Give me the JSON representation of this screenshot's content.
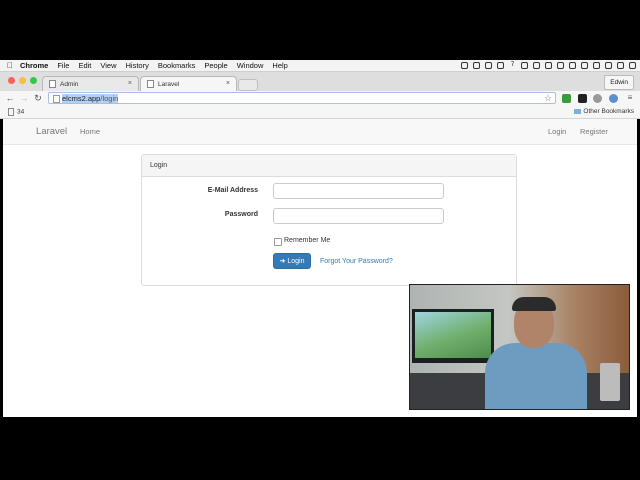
{
  "menubar": {
    "apple_icon": "apple-icon",
    "app_name": "Chrome",
    "menus": [
      "File",
      "Edit",
      "View",
      "History",
      "Bookmarks",
      "People",
      "Window",
      "Help"
    ],
    "status_items": [
      "7"
    ]
  },
  "tabs": [
    {
      "title": "Admin",
      "active": false
    },
    {
      "title": "Laravel",
      "active": true
    }
  ],
  "profile": "Edwin",
  "omnibox": {
    "url_host": "elcms2.app",
    "url_path": "/login"
  },
  "bookmarks": {
    "count_label": "34",
    "other": "Other Bookmarks"
  },
  "site": {
    "brand": "Laravel",
    "nav_home": "Home",
    "nav_login": "Login",
    "nav_register": "Register"
  },
  "login_panel": {
    "heading": "Login",
    "email_label": "E-Mail Address",
    "email_value": "",
    "password_label": "Password",
    "password_value": "",
    "remember_label": "Remember Me",
    "button_label": "Login",
    "forgot_label": "Forgot Your Password?"
  },
  "colors": {
    "primary": "#337ab7",
    "link": "#337ab7",
    "navbar_bg": "#f8f8f8",
    "close_red": "#fc605c",
    "minimize_yellow": "#fdbc40",
    "zoom_green": "#34c84a"
  }
}
